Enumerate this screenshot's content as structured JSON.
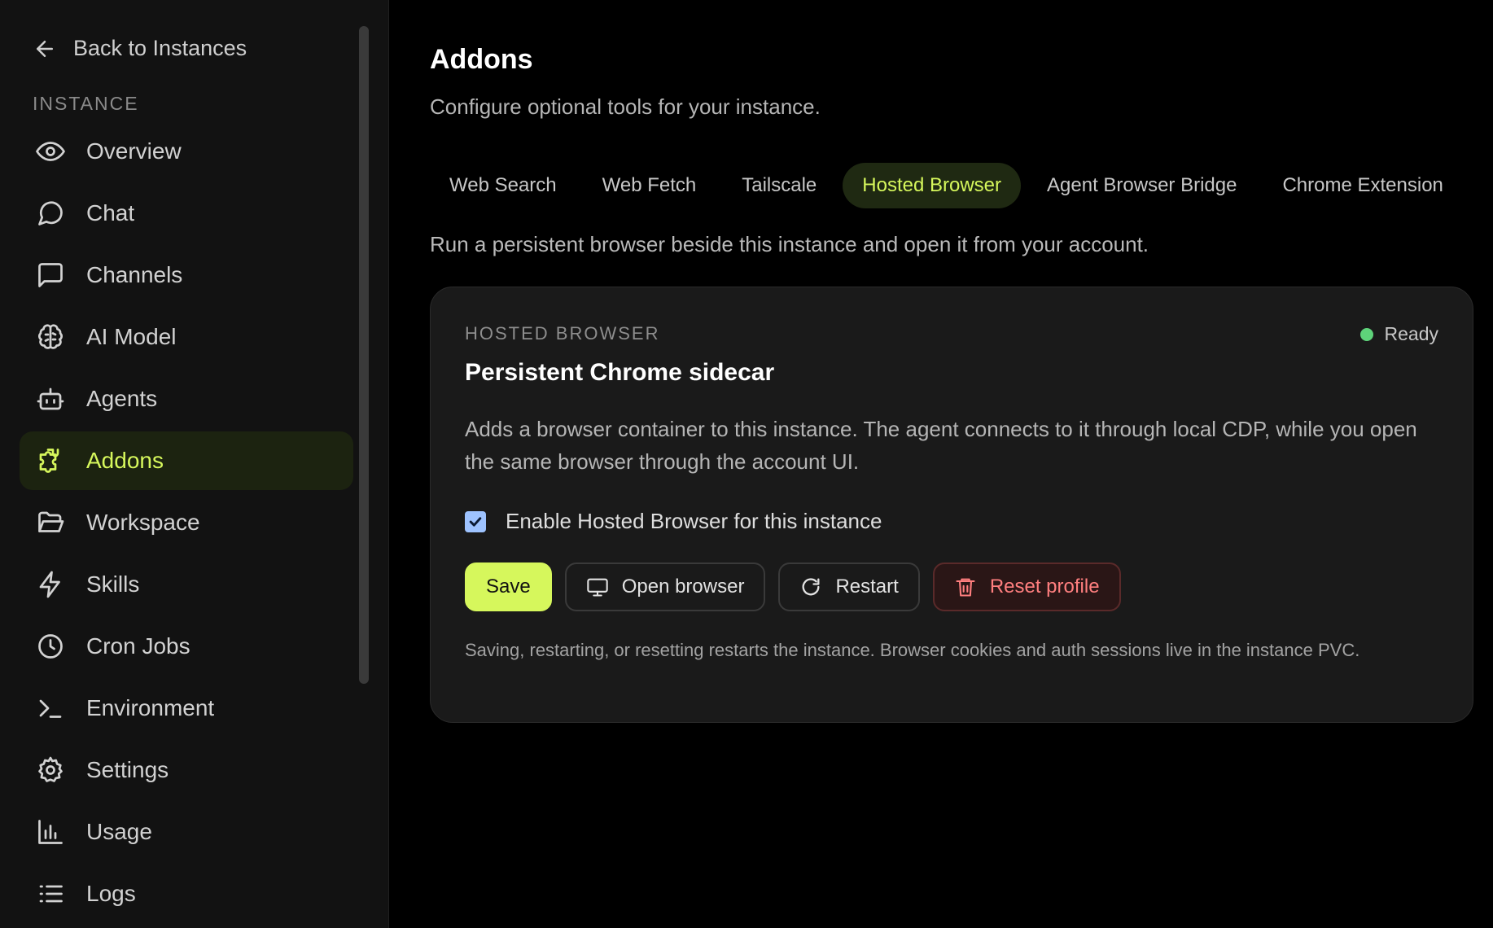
{
  "sidebar": {
    "back_label": "Back to Instances",
    "section_label": "INSTANCE",
    "items": [
      {
        "label": "Overview",
        "icon": "eye-icon"
      },
      {
        "label": "Chat",
        "icon": "chat-icon"
      },
      {
        "label": "Channels",
        "icon": "channels-icon"
      },
      {
        "label": "AI Model",
        "icon": "brain-icon"
      },
      {
        "label": "Agents",
        "icon": "robot-icon"
      },
      {
        "label": "Addons",
        "icon": "puzzle-icon",
        "active": true
      },
      {
        "label": "Workspace",
        "icon": "folder-open-icon"
      },
      {
        "label": "Skills",
        "icon": "lightning-icon"
      },
      {
        "label": "Cron Jobs",
        "icon": "clock-icon"
      },
      {
        "label": "Environment",
        "icon": "terminal-icon"
      },
      {
        "label": "Settings",
        "icon": "gear-icon"
      },
      {
        "label": "Usage",
        "icon": "bar-chart-icon"
      },
      {
        "label": "Logs",
        "icon": "list-icon"
      }
    ]
  },
  "main": {
    "title": "Addons",
    "subtitle": "Configure optional tools for your instance.",
    "tabs": [
      {
        "label": "Web Search"
      },
      {
        "label": "Web Fetch"
      },
      {
        "label": "Tailscale"
      },
      {
        "label": "Hosted Browser",
        "active": true
      },
      {
        "label": "Agent Browser Bridge"
      },
      {
        "label": "Chrome Extension"
      }
    ],
    "tab_description": "Run a persistent browser beside this instance and open it from your account.",
    "card": {
      "eyebrow": "HOSTED BROWSER",
      "status": "Ready",
      "title": "Persistent Chrome sidecar",
      "description": "Adds a browser container to this instance. The agent connects to it through local CDP, while you open the same browser through the account UI.",
      "checkbox_label": "Enable Hosted Browser for this instance",
      "checkbox_checked": true,
      "buttons": {
        "save": "Save",
        "open_browser": "Open browser",
        "restart": "Restart",
        "reset_profile": "Reset profile"
      },
      "note": "Saving, restarting, or resetting restarts the instance. Browser cookies and auth sessions live in the instance PVC."
    }
  },
  "colors": {
    "accent": "#d6f75c",
    "status_ready": "#5ed37a",
    "danger": "#ff7f7f"
  }
}
